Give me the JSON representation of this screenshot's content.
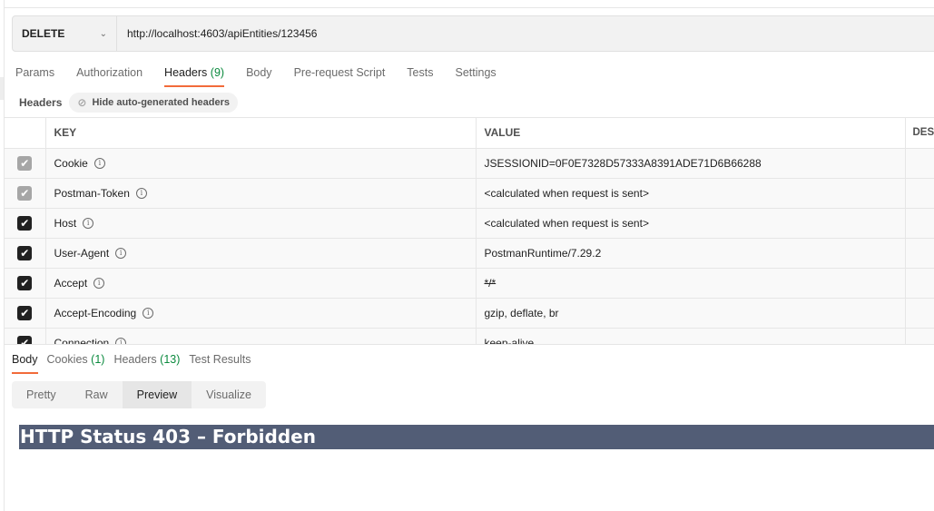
{
  "request": {
    "method": "DELETE",
    "url": "http://localhost:4603/apiEntities/123456"
  },
  "tabs": [
    {
      "label": "Params",
      "count": null
    },
    {
      "label": "Authorization",
      "count": null
    },
    {
      "label": "Headers",
      "count": "(9)",
      "active": true
    },
    {
      "label": "Body",
      "count": null
    },
    {
      "label": "Pre-request Script",
      "count": null
    },
    {
      "label": "Tests",
      "count": null
    },
    {
      "label": "Settings",
      "count": null
    }
  ],
  "headers_section": {
    "title": "Headers",
    "toggle_label": "Hide auto-generated headers",
    "toggle_icon": "eye-slash-icon"
  },
  "table": {
    "columns": [
      "KEY",
      "VALUE",
      "DES"
    ],
    "rows": [
      {
        "key": "Cookie",
        "value": "JSESSIONID=0F0E7328D57333A8391ADE71D6B66288",
        "checked": true,
        "disabled": true
      },
      {
        "key": "Postman-Token",
        "value": "<calculated when request is sent>",
        "checked": true,
        "disabled": true
      },
      {
        "key": "Host",
        "value": "<calculated when request is sent>",
        "checked": true,
        "disabled": false
      },
      {
        "key": "User-Agent",
        "value": "PostmanRuntime/7.29.2",
        "checked": true,
        "disabled": false
      },
      {
        "key": "Accept",
        "value": "*/*",
        "checked": true,
        "disabled": false
      },
      {
        "key": "Accept-Encoding",
        "value": "gzip, deflate, br",
        "checked": true,
        "disabled": false
      },
      {
        "key": "Connection",
        "value": "keep-alive",
        "checked": true,
        "disabled": false
      }
    ]
  },
  "response": {
    "tabs": [
      {
        "label": "Body",
        "count": null,
        "active": true
      },
      {
        "label": "Cookies",
        "count": "(1)"
      },
      {
        "label": "Headers",
        "count": "(13)"
      },
      {
        "label": "Test Results",
        "count": null
      }
    ],
    "view_modes": [
      "Pretty",
      "Raw",
      "Preview",
      "Visualize"
    ],
    "active_view": "Preview",
    "preview_heading": "HTTP Status 403 – Forbidden"
  },
  "colors": {
    "accent": "#f26b3a",
    "count_green": "#0b8a3e",
    "preview_heading_bg": "#525d76"
  }
}
